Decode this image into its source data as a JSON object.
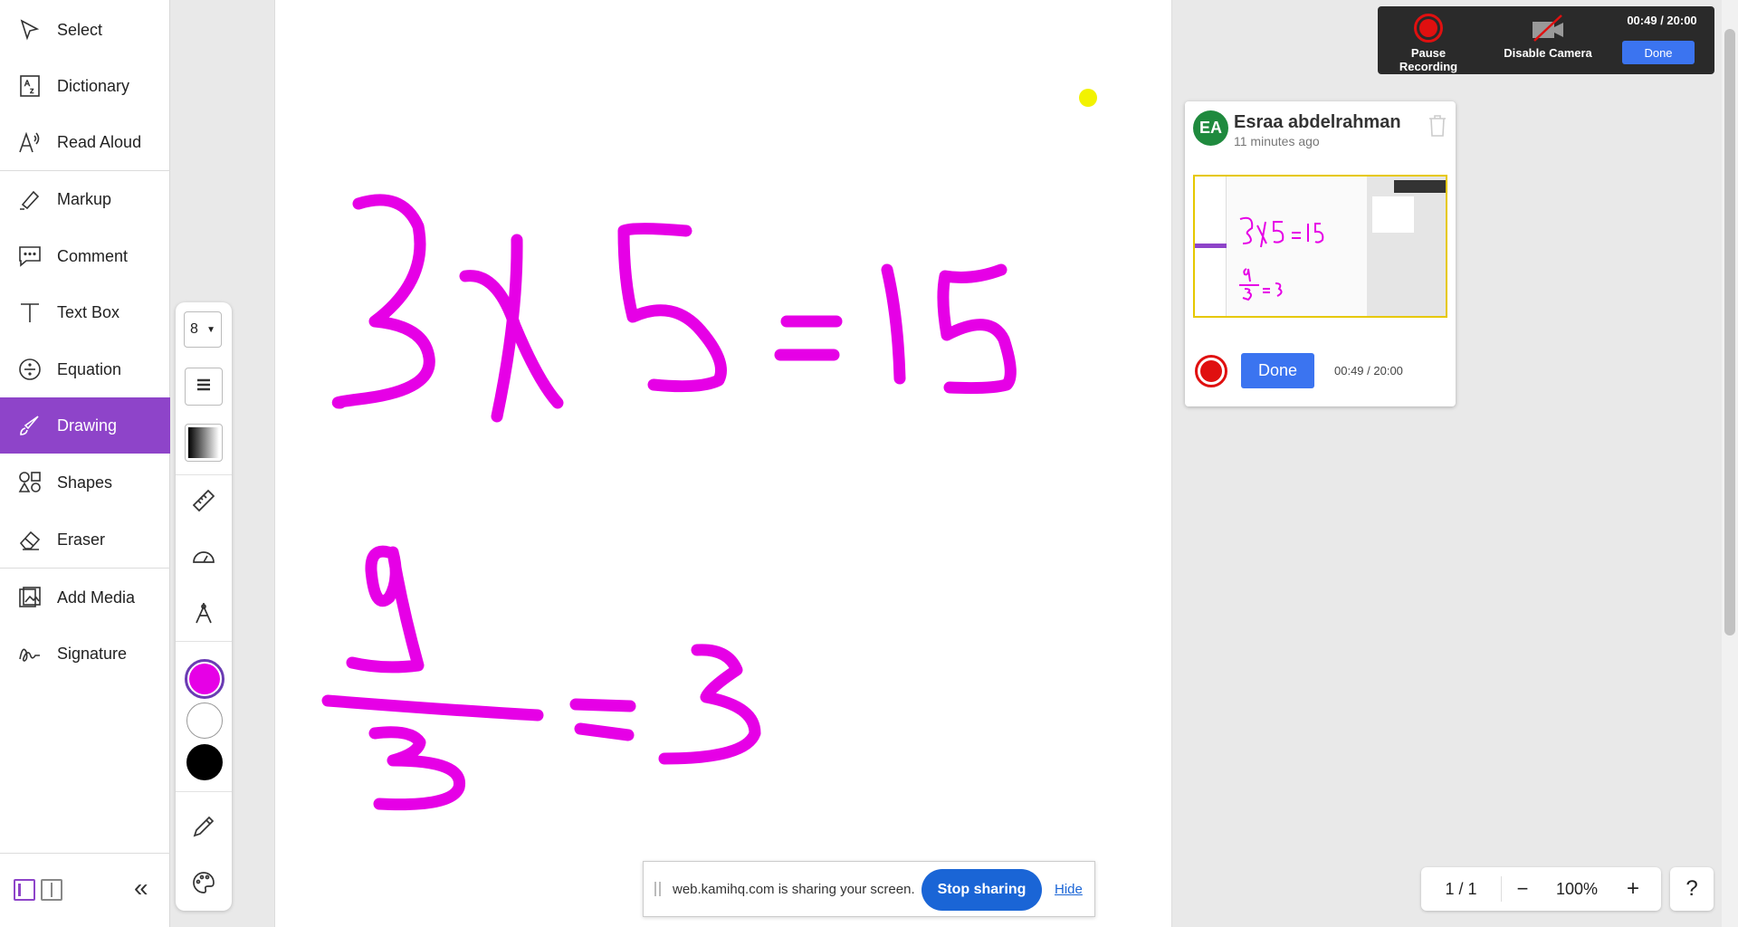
{
  "sidebar": {
    "items": [
      {
        "label": "Select",
        "icon": "cursor-icon"
      },
      {
        "label": "Dictionary",
        "icon": "dictionary-icon"
      },
      {
        "label": "Read Aloud",
        "icon": "read-aloud-icon"
      },
      {
        "label": "Markup",
        "icon": "highlighter-icon"
      },
      {
        "label": "Comment",
        "icon": "comment-icon"
      },
      {
        "label": "Text Box",
        "icon": "text-icon"
      },
      {
        "label": "Equation",
        "icon": "divide-icon"
      },
      {
        "label": "Drawing",
        "icon": "brush-icon",
        "active": true
      },
      {
        "label": "Shapes",
        "icon": "shapes-icon"
      },
      {
        "label": "Eraser",
        "icon": "eraser-icon"
      },
      {
        "label": "Add Media",
        "icon": "image-icon"
      },
      {
        "label": "Signature",
        "icon": "signature-icon"
      }
    ],
    "active_color": "#8e44c9"
  },
  "toolbar": {
    "brush_size": "8",
    "colors": [
      "#e600e6",
      "#ffffff",
      "#000000"
    ],
    "selected_color": "#e600e6"
  },
  "recording": {
    "pause_label": "Pause Recording",
    "camera_label": "Disable Camera",
    "timer": "00:49 / 20:00",
    "done_label": "Done"
  },
  "comment": {
    "initials": "EA",
    "author": "Esraa abdelrahman",
    "time": "11 minutes ago",
    "done_label": "Done",
    "timer": "00:49 / 20:00"
  },
  "share": {
    "message": "web.kamihq.com is sharing your screen.",
    "stop_label": "Stop sharing",
    "hide_label": "Hide"
  },
  "zoom": {
    "page_indicator": "1 / 1",
    "zoom_level": "100%",
    "minus": "−",
    "plus": "+"
  },
  "help": {
    "label": "?"
  }
}
